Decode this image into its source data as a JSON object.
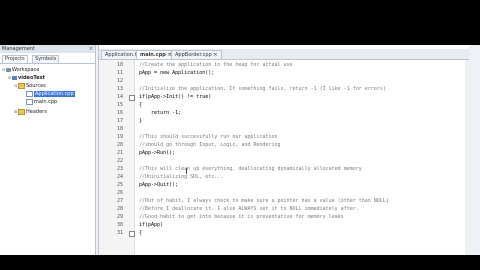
{
  "management": {
    "title": "Management",
    "close": "×",
    "tabs": [
      "Projects",
      "Symbols"
    ],
    "tree": [
      {
        "label": "Workspace",
        "icon": "workspace-icon",
        "toggle": "⊟"
      },
      {
        "label": "videoTest",
        "icon": "project-icon",
        "toggle": "⊟"
      },
      {
        "label": "Sources",
        "icon": "folder-icon",
        "toggle": "⊟"
      },
      {
        "label": "Application.cpp",
        "icon": "cpp-file-icon",
        "toggle": "",
        "selected": true
      },
      {
        "label": "main.cpp",
        "icon": "cpp-file-icon",
        "toggle": ""
      },
      {
        "label": "Headers",
        "icon": "folder-icon",
        "toggle": "⊞"
      }
    ]
  },
  "editor": {
    "tabs": [
      {
        "label": "Application.h",
        "active": false
      },
      {
        "label": "main.cpp",
        "active": true
      },
      {
        "label": "AppBorder.cpp",
        "active": false
      }
    ],
    "tab_close": "×",
    "line_numbers": [
      "10",
      "11",
      "12",
      "13",
      "14",
      "15",
      "16",
      "17",
      "18",
      "19",
      "20",
      "21",
      "22",
      "23",
      "24",
      "25",
      "26",
      "27",
      "28",
      "29",
      "30",
      "31"
    ],
    "lines": [
      {
        "text": "//Create the application in the heap for actual use",
        "type": "comment"
      },
      {
        "text": "pApp = new Application();",
        "type": "code"
      },
      {
        "text": "",
        "type": "code"
      },
      {
        "text": "//Initialize the application. If something fails, return -1 (I like -1 for errors)",
        "type": "comment"
      },
      {
        "text": "if(pApp->Init() != true)",
        "type": "code"
      },
      {
        "text": "{",
        "type": "code"
      },
      {
        "text": "    return -1;",
        "type": "code"
      },
      {
        "text": "}",
        "type": "code"
      },
      {
        "text": "",
        "type": "code"
      },
      {
        "text": "//This should successfully run our application",
        "type": "comment"
      },
      {
        "text": "//should go through Input, Logic, and Rendering",
        "type": "comment"
      },
      {
        "text": "pApp->Run();",
        "type": "code"
      },
      {
        "text": "",
        "type": "code"
      },
      {
        "text": "//This will clean up everything, deallocating dynamically allocated memory",
        "type": "comment"
      },
      {
        "text": "//Uninitializing SDL, etc...",
        "type": "comment"
      },
      {
        "text": "pApp->Quit();",
        "type": "code"
      },
      {
        "text": "",
        "type": "code"
      },
      {
        "text": "//Out of habit, I always check to make sure a pointer has a value (other than NULL)",
        "type": "comment"
      },
      {
        "text": "//Before I deallocate it. I also ALWAYS set it to NULL immediately after.",
        "type": "comment"
      },
      {
        "text": "//Good habit to get into because it is preventative for memory leaks",
        "type": "comment"
      },
      {
        "text": "if(pApp)",
        "type": "code"
      },
      {
        "text": "{",
        "type": "code"
      }
    ]
  }
}
